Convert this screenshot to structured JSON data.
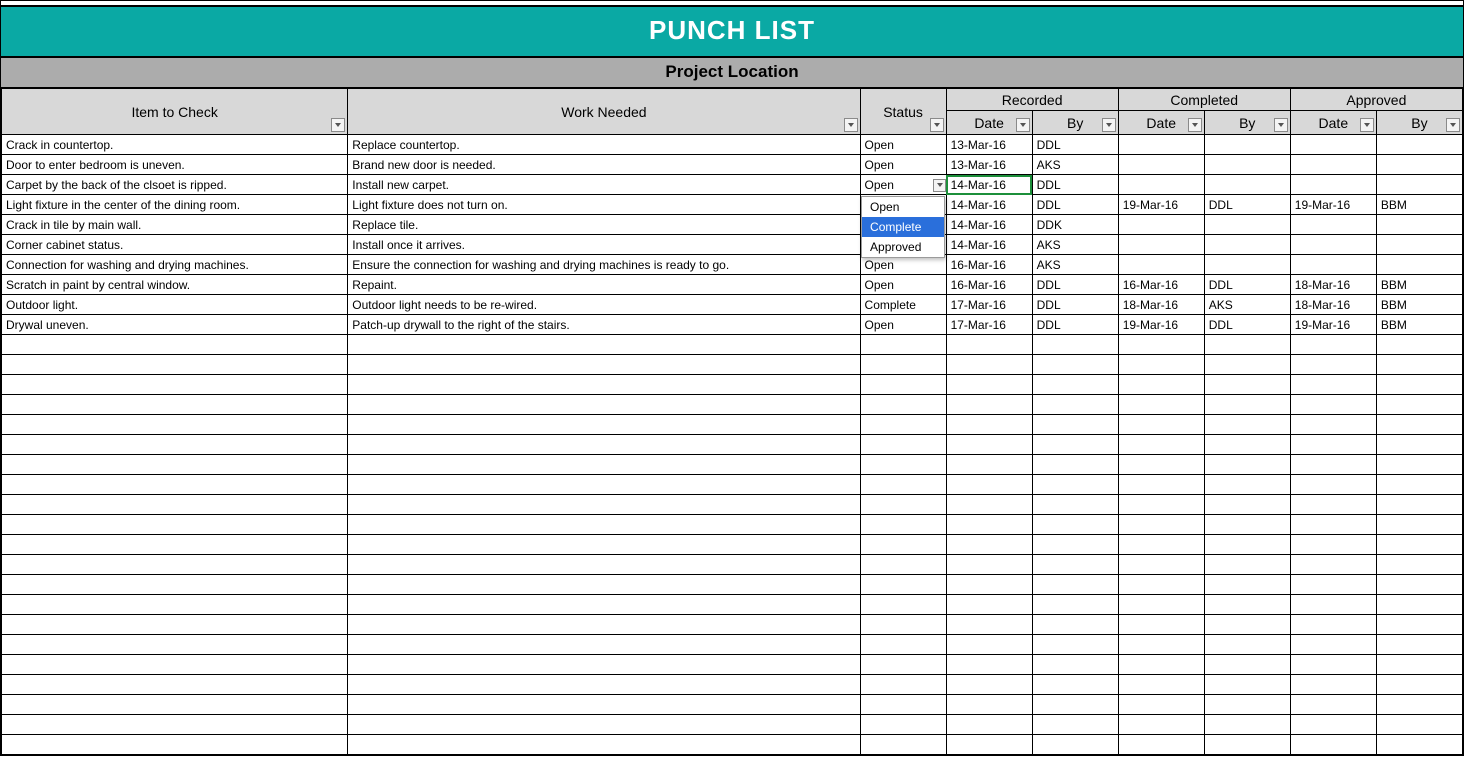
{
  "title": "PUNCH LIST",
  "location_label": "Project Location",
  "headers": {
    "item": "Item to Check",
    "work": "Work Needed",
    "status": "Status",
    "recorded": "Recorded",
    "completed": "Completed",
    "approved": "Approved",
    "date": "Date",
    "by": "By"
  },
  "dropdown": {
    "options": [
      "Open",
      "Complete",
      "Approved"
    ],
    "selected_index": 1
  },
  "rows": [
    {
      "item": "Crack in countertop.",
      "work": "Replace countertop.",
      "status": "Open",
      "rdate": "13-Mar-16",
      "rby": "DDL",
      "cdate": "",
      "cby": "",
      "adate": "",
      "aby": ""
    },
    {
      "item": "Door to enter bedroom is uneven.",
      "work": "Brand new door is needed.",
      "status": "Open",
      "rdate": "13-Mar-16",
      "rby": "AKS",
      "cdate": "",
      "cby": "",
      "adate": "",
      "aby": ""
    },
    {
      "item": "Carpet by the back of the clsoet is ripped.",
      "work": "Install new carpet.",
      "status": "Open",
      "rdate": "14-Mar-16",
      "rby": "DDL",
      "cdate": "",
      "cby": "",
      "adate": "",
      "aby": ""
    },
    {
      "item": "Light fixture in the center of the dining room.",
      "work": "Light fixture does not turn on.",
      "status": "",
      "rdate": "14-Mar-16",
      "rby": "DDL",
      "cdate": "19-Mar-16",
      "cby": "DDL",
      "adate": "19-Mar-16",
      "aby": "BBM"
    },
    {
      "item": "Crack in tile by main wall.",
      "work": "Replace tile.",
      "status": "",
      "rdate": "14-Mar-16",
      "rby": "DDK",
      "cdate": "",
      "cby": "",
      "adate": "",
      "aby": ""
    },
    {
      "item": "Corner cabinet status.",
      "work": "Install once it arrives.",
      "status": "",
      "rdate": "14-Mar-16",
      "rby": "AKS",
      "cdate": "",
      "cby": "",
      "adate": "",
      "aby": ""
    },
    {
      "item": "Connection for washing and drying machines.",
      "work": "Ensure the connection for washing and drying machines is ready to go.",
      "status": "Open",
      "rdate": "16-Mar-16",
      "rby": "AKS",
      "cdate": "",
      "cby": "",
      "adate": "",
      "aby": ""
    },
    {
      "item": "Scratch in paint by central window.",
      "work": "Repaint.",
      "status": "Open",
      "rdate": "16-Mar-16",
      "rby": "DDL",
      "cdate": "16-Mar-16",
      "cby": "DDL",
      "adate": "18-Mar-16",
      "aby": "BBM"
    },
    {
      "item": "Outdoor light.",
      "work": "Outdoor light needs to be re-wired.",
      "status": "Complete",
      "rdate": "17-Mar-16",
      "rby": "DDL",
      "cdate": "18-Mar-16",
      "cby": "AKS",
      "adate": "18-Mar-16",
      "aby": "BBM"
    },
    {
      "item": "Drywal uneven.",
      "work": "Patch-up drywall to the right of the stairs.",
      "status": "Open",
      "rdate": "17-Mar-16",
      "rby": "DDL",
      "cdate": "19-Mar-16",
      "cby": "DDL",
      "adate": "19-Mar-16",
      "aby": "BBM"
    }
  ],
  "empty_rows": 21,
  "colors": {
    "teal": "#0aa9a4",
    "header_bg": "#d8d8d8",
    "location_bg": "#acacac",
    "selection_green": "#1c8f3a",
    "dropdown_highlight": "#2a6fdb"
  }
}
